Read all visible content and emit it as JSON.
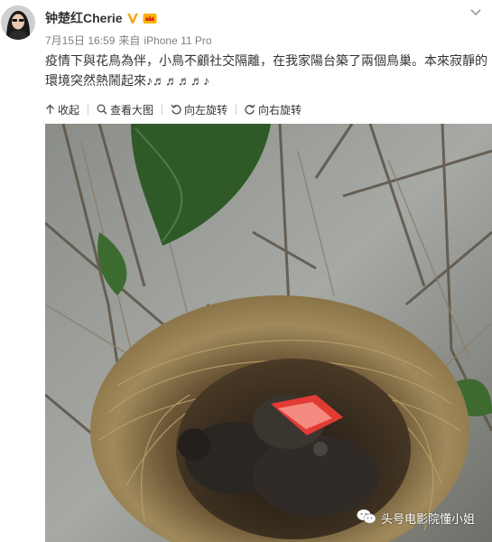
{
  "post": {
    "username": "钟楚红Cherie",
    "date": "7月15日 16:59",
    "source_prefix": "来自",
    "source_device": "iPhone 11 Pro",
    "text": "疫情下與花鳥為伴，小鳥不顧社交隔離，在我家陽台築了兩個鳥巢。本來寂靜的環境突然熱鬧起來♪♬♬♬♬♪"
  },
  "toolbar": {
    "collapse_label": "收起",
    "view_large_label": "查看大图",
    "rotate_left_label": "向左旋转",
    "rotate_right_label": "向右旋转"
  },
  "watermark": {
    "text": "头号电影院懂小姐"
  },
  "colors": {
    "text": "#333333",
    "meta": "#808080",
    "vip": "#f5a623",
    "background": "#ffffff"
  },
  "icons": [
    "verified-v-icon",
    "member-crown-icon",
    "chevron-down-icon",
    "collapse-arrow-icon",
    "magnifier-icon",
    "rotate-left-icon",
    "rotate-right-icon",
    "wechat-icon"
  ]
}
